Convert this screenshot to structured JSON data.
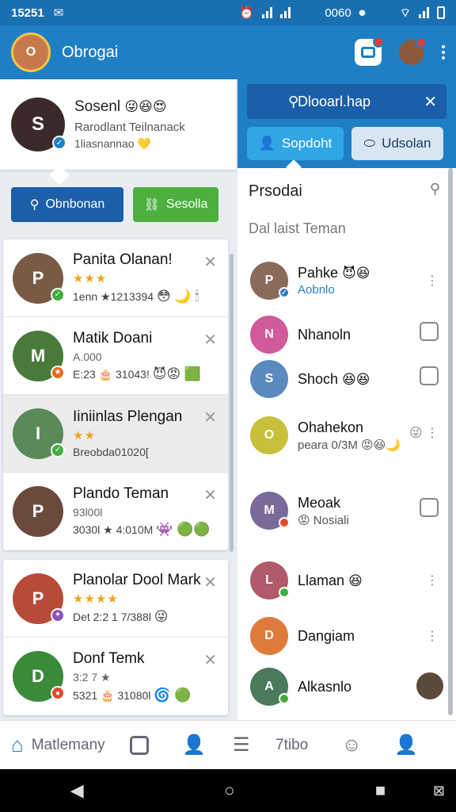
{
  "status_bar": {
    "time": "15251",
    "left_icon": "📶",
    "right_left_text": "0060",
    "colors": {
      "bg": "#1a6fb0"
    }
  },
  "app_bar": {
    "title": "Obrogai",
    "avatar_initial": "O",
    "colors": {
      "bg": "#1f7fc4"
    }
  },
  "profile": {
    "name": "Sosenl",
    "emojis": "😜😆😍",
    "subtitle": "Rarodlant Teilnanack",
    "subtitle2": "1liasnannao",
    "subtitle2_icon": "💛",
    "initial": "S"
  },
  "left_buttons": {
    "primary": {
      "label": "Obnbonan",
      "icon": "search-icon"
    },
    "secondary": {
      "label": "Sesolla",
      "icon": "link-icon"
    }
  },
  "friends": [
    {
      "name": "Panita Olanan!",
      "stars": "★★★",
      "meta": "1enn ★1213394",
      "emojis": "😳 🌙 🕯",
      "initial": "P",
      "pip_color": "#3fae3a",
      "selected": false
    },
    {
      "name": "Matik Doani",
      "stars": "A.000",
      "meta": "E:23 🎂 31043!",
      "emojis": "😈😡 🟩",
      "initial": "M",
      "pip_color": "#e06a22",
      "selected": false
    },
    {
      "name": "Iiniinlas Plengan",
      "stars": "★★",
      "meta": "Breobda01020[",
      "emojis": "",
      "initial": "I",
      "pip_color": "#3fae3a",
      "selected": true
    },
    {
      "name": "Plando Teman",
      "stars": "93l00l",
      "meta": "3030l ★ 4:010M",
      "emojis": "👾 🟢🟢",
      "initial": "P",
      "pip_color": "#3fae3a",
      "selected": false
    },
    {
      "name": "Planolar Dool Mark",
      "stars": "★★★★",
      "meta": "Det 2:2 1 7/388l",
      "emojis": "😜",
      "initial": "P",
      "pip_color": "#8b4fc2",
      "selected": false
    },
    {
      "name": "Donf Temk",
      "stars": "3:2 7 ★",
      "meta": "5321 🎂 31080l",
      "emojis": "🌀 🟢",
      "initial": "D",
      "pip_color": "#e04a2a",
      "selected": false
    }
  ],
  "right_panel": {
    "search_query": "Dlooarl.hap",
    "tabs": [
      {
        "label": "Sopdoht",
        "icon": "user-icon",
        "active": true
      },
      {
        "label": "Udsolan",
        "icon": "tag-icon",
        "active": false
      }
    ],
    "list_title": "Prsodai",
    "list_subtitle": "Dal laist Teman",
    "items": [
      {
        "name": "Pahke",
        "name_emojis": "😈😆",
        "sub": "Aobnlo",
        "sub_style": "blue",
        "trail": "kebab",
        "initial": "P",
        "pip_color": "#2b7dc4"
      },
      {
        "name": "Nhanoln",
        "name_emojis": "",
        "sub": "",
        "sub_style": "",
        "trail": "square",
        "initial": "N",
        "pip_color": ""
      },
      {
        "name": "Shoch",
        "name_emojis": "😆😆",
        "sub": "",
        "sub_style": "",
        "trail": "square",
        "initial": "S",
        "pip_color": ""
      },
      {
        "name": "Ohahekon",
        "name_emojis": "",
        "sub": "peara 0/3M 😡😆🌙",
        "sub_style": "gray",
        "trail": "emoji",
        "initial": "O",
        "pip_color": ""
      },
      {
        "name": "Meoak",
        "name_emojis": "",
        "sub": "😡 Nosiali",
        "sub_style": "gray",
        "trail": "square",
        "initial": "M",
        "pip_color": "#e04a2a"
      },
      {
        "name": "Llaman",
        "name_emojis": "😆",
        "sub": "",
        "sub_style": "",
        "trail": "kebab",
        "initial": "L",
        "pip_color": "#3fae3a"
      },
      {
        "name": "Dangiam",
        "name_emojis": "",
        "sub": "",
        "sub_style": "",
        "trail": "kebab",
        "initial": "D",
        "pip_color": ""
      },
      {
        "name": "Alkasnlo",
        "name_emojis": "",
        "sub": "",
        "sub_style": "",
        "trail": "avatar",
        "initial": "A",
        "pip_color": "#3fae3a"
      }
    ]
  },
  "bottom_nav": {
    "home_label": "Matlemany",
    "tribe_label": "7tibo"
  }
}
